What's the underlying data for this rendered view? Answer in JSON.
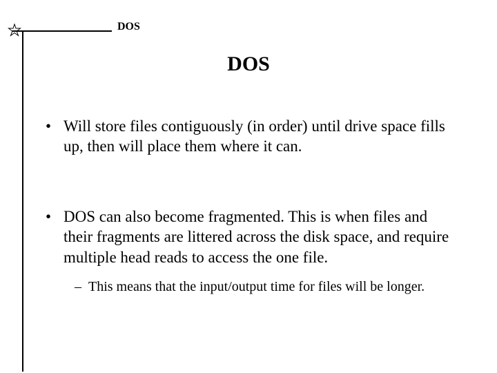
{
  "header": {
    "label": "DOS"
  },
  "title": "DOS",
  "bullets": [
    {
      "text": "Will store files contiguously (in order) until drive space fills up, then will place them where it can.",
      "sub": []
    },
    {
      "text": "DOS can also become fragmented. This is when files and their fragments are littered across the disk space, and require multiple head reads to access the one file.",
      "sub": [
        {
          "text": "This means that the input/output time for files will be longer."
        }
      ]
    }
  ]
}
